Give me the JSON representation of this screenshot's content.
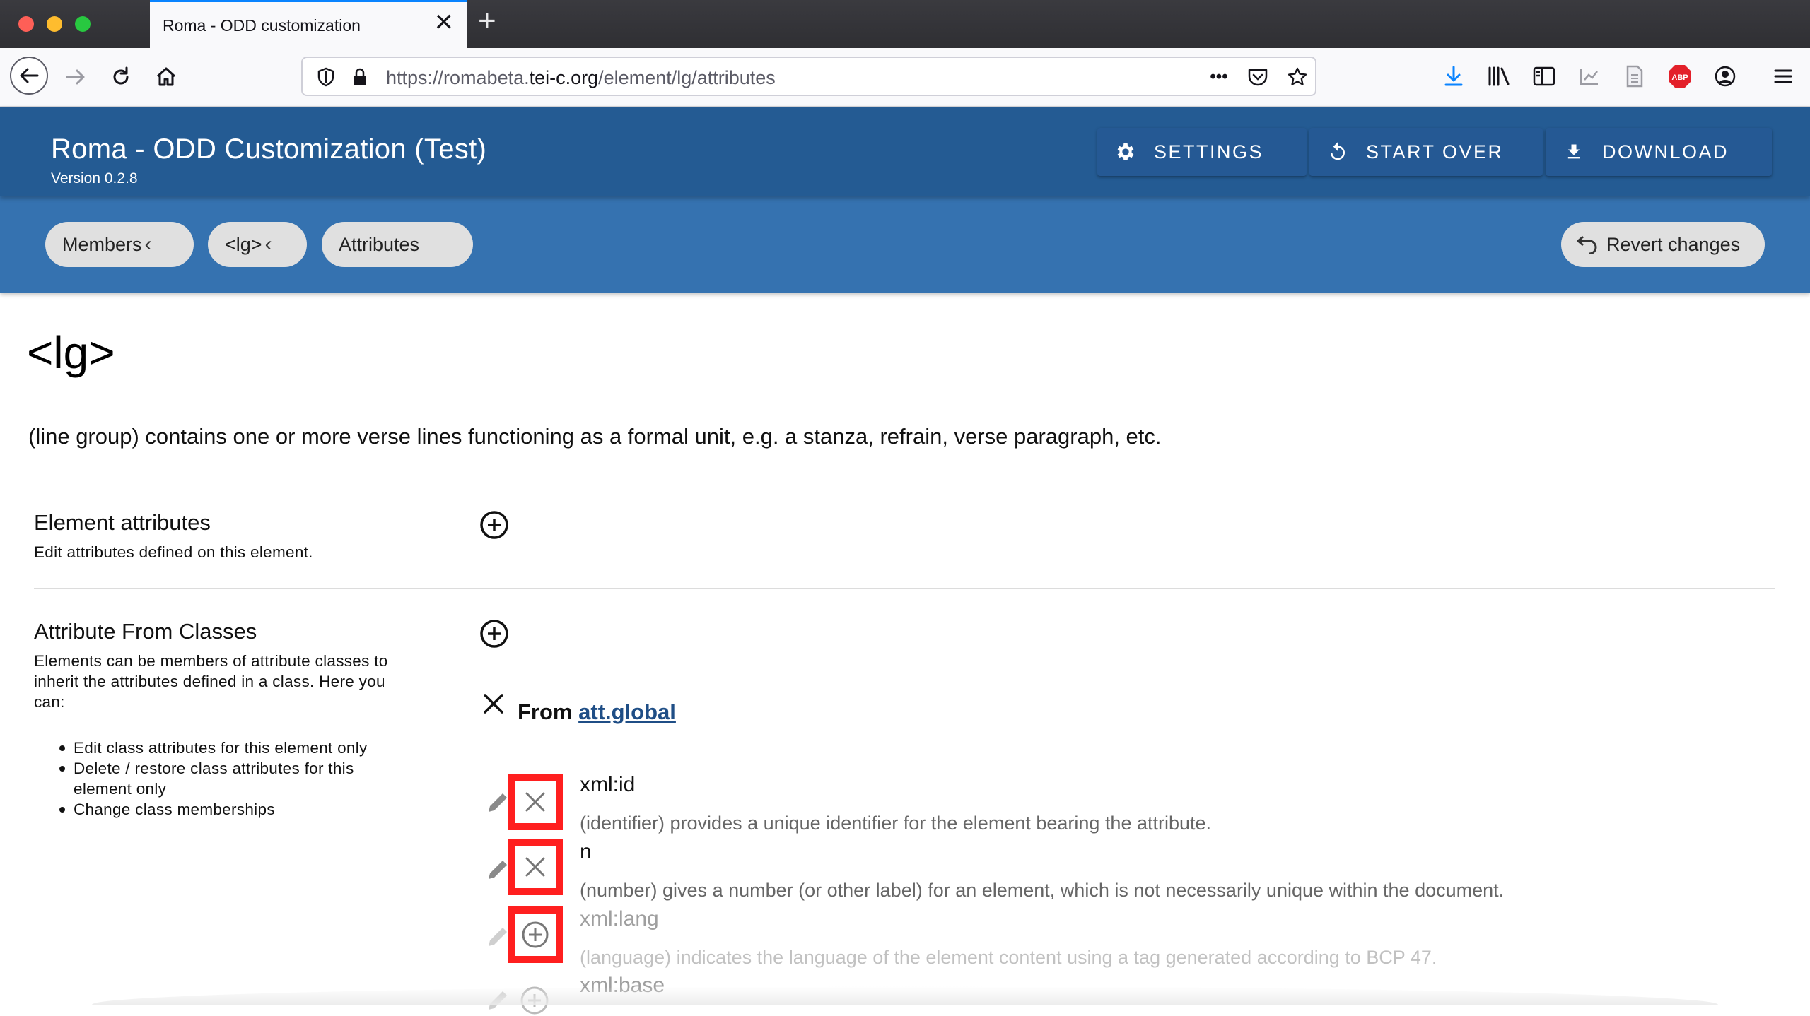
{
  "browser": {
    "tab_title": "Roma - ODD customization",
    "url_prefix": "https://romabeta.",
    "url_host": "tei-c.org",
    "url_path": "/element/lg/attributes",
    "url_more": "•••"
  },
  "app": {
    "title": "Roma - ODD Customization (Test)",
    "version": "Version 0.2.8",
    "buttons": {
      "settings": "SETTINGS",
      "start_over": "START OVER",
      "download": "DOWNLOAD"
    }
  },
  "breadcrumbs": {
    "members": "Members",
    "lg": "<lg>",
    "attributes": "Attributes",
    "revert": "Revert changes"
  },
  "element": {
    "heading": "<lg>",
    "description": "(line group) contains one or more verse lines functioning as a formal unit, e.g. a stanza, refrain, verse paragraph, etc."
  },
  "sections": {
    "element_attributes": {
      "title": "Element attributes",
      "subtitle": "Edit attributes defined on this element."
    },
    "attribute_from_classes": {
      "title": "Attribute From Classes",
      "line1": "Elements can be members of attribute classes to",
      "line2": "inherit the attributes defined in a class. Here you",
      "line3": "can:",
      "bullets": [
        "Edit class attributes for this element only",
        "Delete / restore class attributes for this",
        "element only",
        "Change class memberships"
      ]
    }
  },
  "class_group": {
    "from_label": "From",
    "class_name": "att.global"
  },
  "attributes": [
    {
      "name": "xml:id",
      "desc": "(identifier) provides a unique identifier for the element bearing the attribute.",
      "state": "active"
    },
    {
      "name": "n",
      "desc": "(number) gives a number (or other label) for an element, which is not necessarily unique within the document.",
      "state": "active"
    },
    {
      "name": "xml:lang",
      "desc": "(language) indicates the language of the element content using a tag generated according to BCP 47.",
      "state": "deleted"
    },
    {
      "name": "xml:base",
      "desc": "",
      "state": "deleted"
    }
  ],
  "colors": {
    "appbar": "#245b93",
    "subbar": "#3572b0",
    "highlight": "#ff1f1f",
    "link": "#1f4e86"
  }
}
